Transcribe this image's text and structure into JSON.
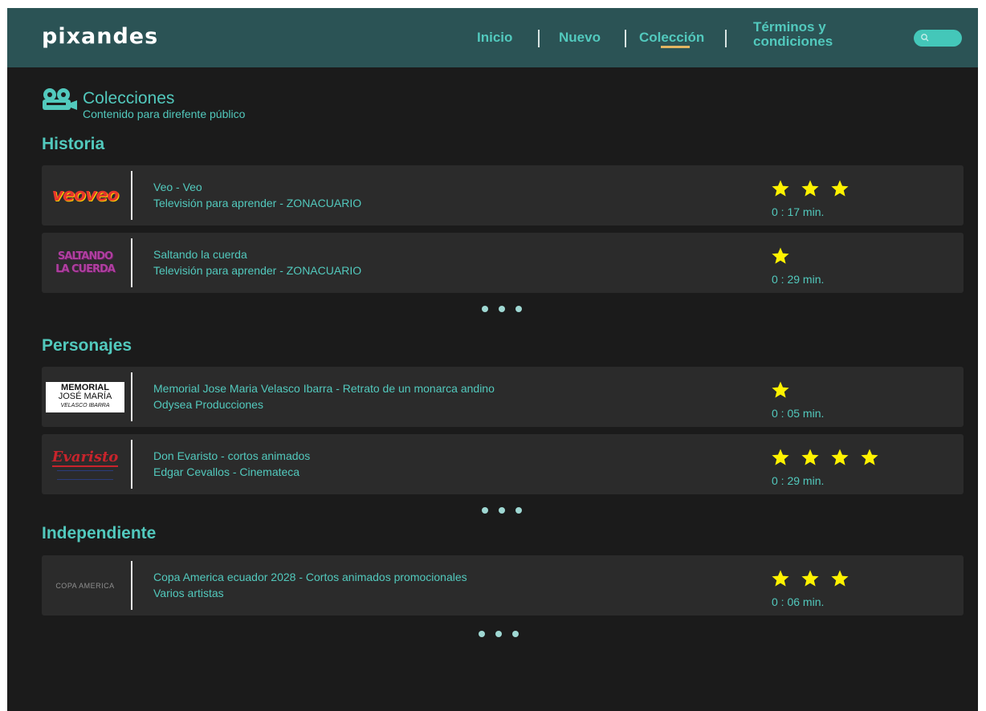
{
  "brand": {
    "logo_text": "pixandes"
  },
  "nav": {
    "items": [
      {
        "label": "Inicio"
      },
      {
        "label": "Nuevo"
      },
      {
        "label": "Colección",
        "active": true
      },
      {
        "label": "Términos y condiciones"
      }
    ],
    "terms_line1": "Términos y",
    "terms_line2": "condiciones",
    "search_icon": "search-icon"
  },
  "page": {
    "title": "Colecciones",
    "subtitle": "Contenido para direfente público",
    "icon": "projector-icon"
  },
  "sections": [
    {
      "title": "Historia",
      "items": [
        {
          "thumb_text": "veoveo",
          "title": "Veo - Veo",
          "subtitle": "Televisión para aprender - ZONACUARIO",
          "rating": 3,
          "duration": "0 : 17 min."
        },
        {
          "thumb_line1": "SALTANDO",
          "thumb_line2": "LA CUERDA",
          "title": "Saltando la cuerda",
          "subtitle": "Televisión para aprender - ZONACUARIO",
          "rating": 1,
          "duration": "0 : 29 min."
        }
      ]
    },
    {
      "title": "Personajes",
      "items": [
        {
          "thumb_line1": "MEMORIAL",
          "thumb_line2": "JOSÉ MARÍA",
          "thumb_line3": "VELASCO IBARRA",
          "title": "Memorial Jose Maria Velasco Ibarra - Retrato de un monarca andino",
          "subtitle": "Odysea Producciones",
          "rating": 1,
          "duration": "0 : 05 min."
        },
        {
          "thumb_text": "Evaristo",
          "title": "Don Evaristo - cortos animados",
          "subtitle": "Edgar Cevallos -  Cinemateca",
          "rating": 4,
          "duration": "0 : 29 min."
        }
      ]
    },
    {
      "title": "Independiente",
      "items": [
        {
          "thumb_text": "COPA AMERICA",
          "title": "Copa America ecuador 2028 - Cortos animados promocionales",
          "subtitle": "Varios artistas",
          "rating": 3,
          "duration": "0 : 06 min."
        }
      ]
    }
  ],
  "colors": {
    "header_bg": "#2b5355",
    "accent": "#52c9bd",
    "page_bg": "#1b1b1b",
    "row_bg": "#2b2b2b",
    "star": "#fff200",
    "active_underline": "#e3b562"
  }
}
